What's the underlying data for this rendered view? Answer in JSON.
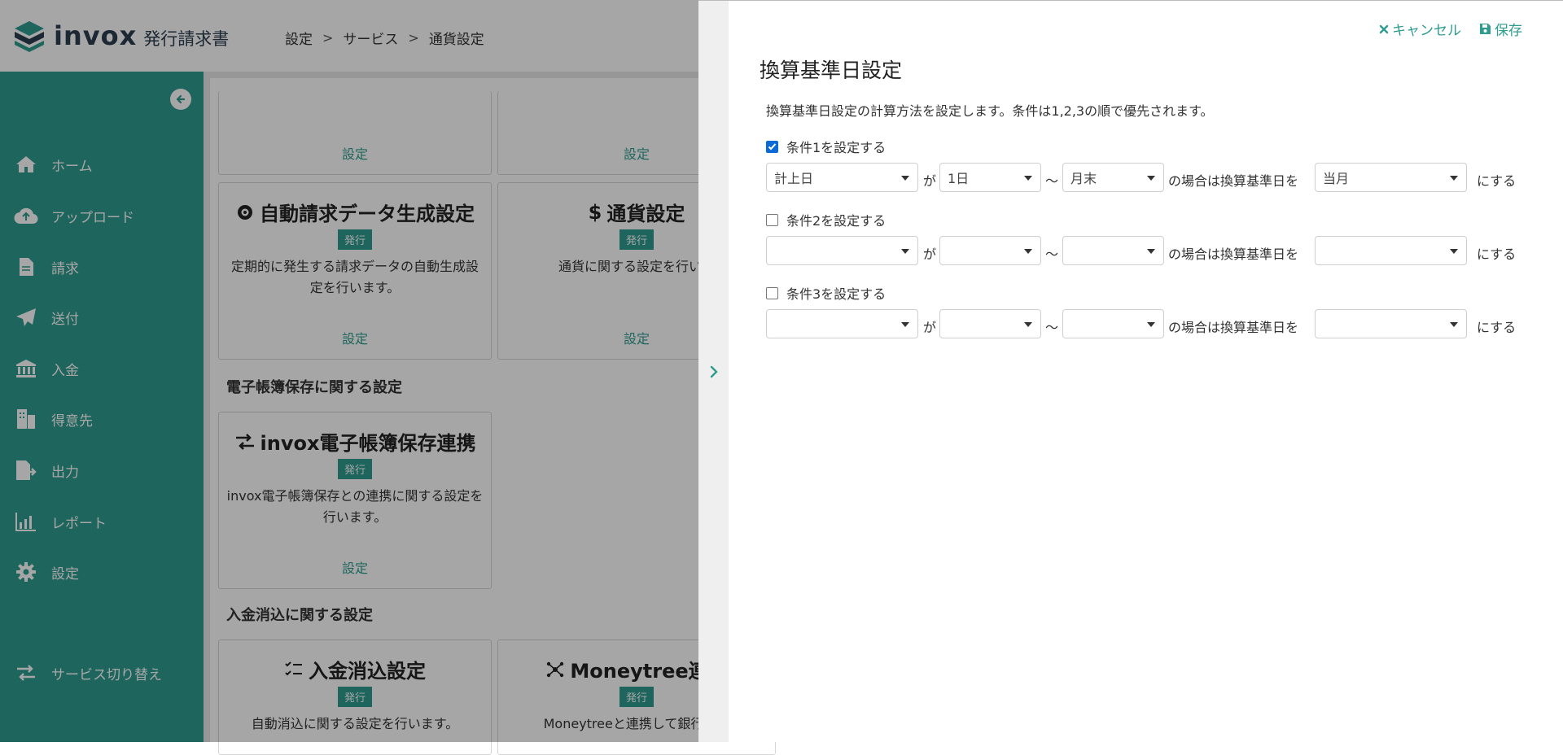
{
  "header": {
    "logo_word": "invox",
    "logo_sub": "発行請求書",
    "breadcrumb": [
      "設定",
      "サービス",
      "通貨設定"
    ]
  },
  "sidebar": {
    "collapse_icon": "arrow-left-circle-icon",
    "items": [
      {
        "label": "ホーム",
        "icon": "home-icon"
      },
      {
        "label": "アップロード",
        "icon": "cloud-upload-icon"
      },
      {
        "label": "請求",
        "icon": "document-icon"
      },
      {
        "label": "送付",
        "icon": "paper-plane-icon"
      },
      {
        "label": "入金",
        "icon": "bank-icon"
      },
      {
        "label": "得意先",
        "icon": "building-icon"
      },
      {
        "label": "出力",
        "icon": "file-export-icon"
      },
      {
        "label": "レポート",
        "icon": "chart-icon"
      },
      {
        "label": "設定",
        "icon": "gear-icon"
      },
      {
        "label": "サービス切り替え",
        "icon": "swap-icon"
      }
    ]
  },
  "content": {
    "top_cards": [
      {
        "link": "設定"
      },
      {
        "link": "設定"
      }
    ],
    "cards": [
      {
        "title": "自動請求データ生成設定",
        "badge": "発行",
        "desc": "定期的に発生する請求データの自動生成設定を行います。",
        "link": "設定",
        "icon": "gear-badge-icon"
      },
      {
        "title": "通貨設定",
        "badge": "発行",
        "desc": "通貨に関する設定を行いま",
        "link": "設定",
        "icon": "dollar-icon"
      },
      {
        "title": "invox電子帳簿保存連携",
        "badge": "発行",
        "desc": "invox電子帳簿保存との連携に関する設定を行います。",
        "link": "設定",
        "icon": "swap-icon"
      },
      {
        "title": "入金消込設定",
        "badge": "発行",
        "desc": "自動消込に関する設定を行います。",
        "icon": "checklist-icon"
      },
      {
        "title": "Moneytree連携",
        "badge": "発行",
        "desc": "Moneytreeと連携して銀行口座",
        "icon": "network-icon"
      }
    ],
    "sections": [
      "電子帳簿保存に関する設定",
      "入金消込に関する設定"
    ]
  },
  "drawer": {
    "handle_icon": "chevron-right-icon",
    "cancel_label": "キャンセル",
    "save_label": "保存",
    "title": "換算基準日設定",
    "description": "換算基準日設定の計算方法を設定します。条件は1,2,3の順で優先されます。",
    "text_ga": "が",
    "text_tilde": "〜",
    "text_when": "の場合は換算基準日を",
    "text_make": "にする",
    "conditions": [
      {
        "label": "条件1を設定する",
        "checked": true,
        "base": "計上日",
        "from": "1日",
        "to": "月末",
        "result": "当月"
      },
      {
        "label": "条件2を設定する",
        "checked": false,
        "base": "",
        "from": "",
        "to": "",
        "result": ""
      },
      {
        "label": "条件3を設定する",
        "checked": false,
        "base": "",
        "from": "",
        "to": "",
        "result": ""
      }
    ]
  },
  "colors": {
    "accent": "#2e9c8f",
    "checkbox": "#0b6bd6"
  }
}
